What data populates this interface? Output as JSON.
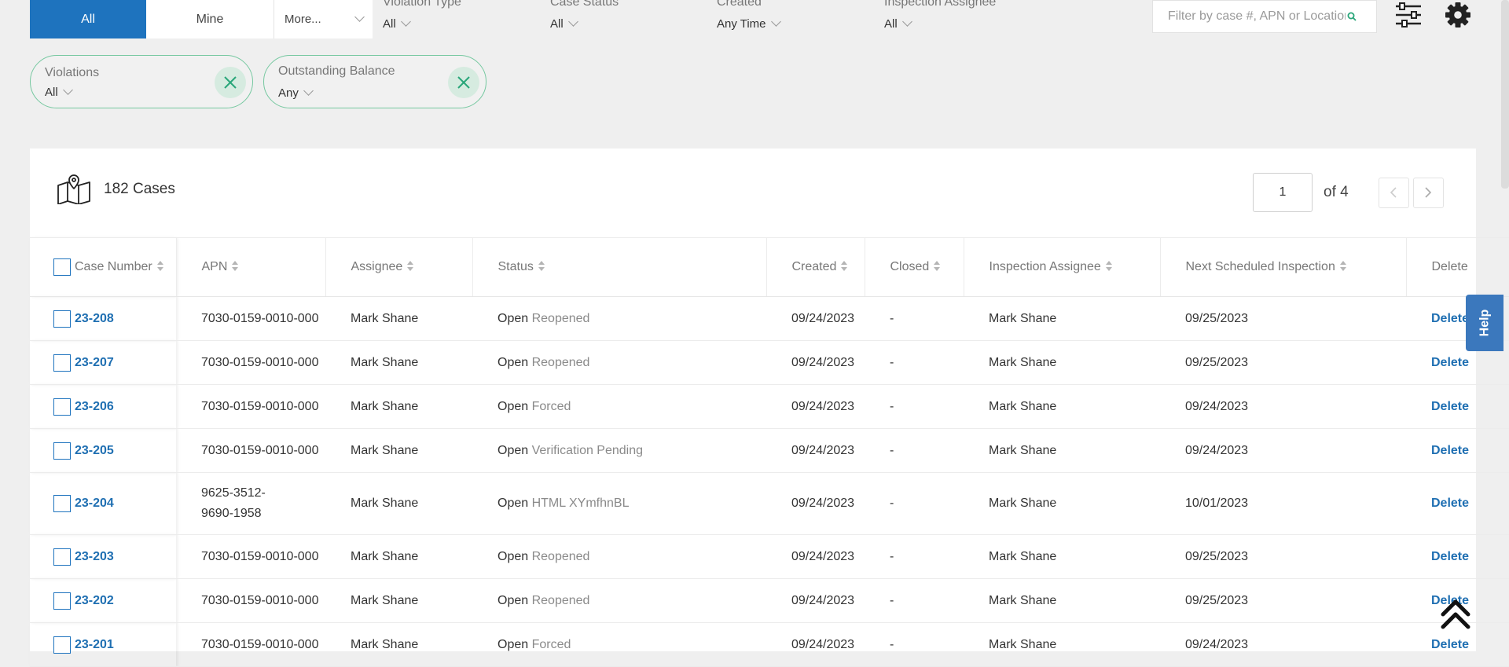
{
  "tabs": {
    "all": "All",
    "mine": "Mine",
    "more": "More..."
  },
  "filters": [
    {
      "label": "Violation Type",
      "value": "All"
    },
    {
      "label": "Case Status",
      "value": "All"
    },
    {
      "label": "Created",
      "value": "Any Time"
    },
    {
      "label": "Inspection Assignee",
      "value": "All"
    }
  ],
  "search": {
    "placeholder": "Filter by case #, APN or Location"
  },
  "chips": [
    {
      "label": "Violations",
      "value": "All"
    },
    {
      "label": "Outstanding Balance",
      "value": "Any"
    }
  ],
  "cases": {
    "count_label": "182 Cases"
  },
  "pager": {
    "page": "1",
    "of_label": "of 4"
  },
  "table": {
    "headers": [
      "Case Number",
      "APN",
      "Assignee",
      "Status",
      "Created",
      "Closed",
      "Inspection Assignee",
      "Next Scheduled Inspection",
      "Delete"
    ],
    "rows": [
      {
        "case": "23-208",
        "apn": "7030-0159-0010-000",
        "assignee": "Mark Shane",
        "status": "Open",
        "substatus": "Reopened",
        "created": "09/24/2023",
        "closed": "-",
        "inspector": "Mark Shane",
        "next": "09/25/2023",
        "action": "Delete"
      },
      {
        "case": "23-207",
        "apn": "7030-0159-0010-000",
        "assignee": "Mark Shane",
        "status": "Open",
        "substatus": "Reopened",
        "created": "09/24/2023",
        "closed": "-",
        "inspector": "Mark Shane",
        "next": "09/25/2023",
        "action": "Delete"
      },
      {
        "case": "23-206",
        "apn": "7030-0159-0010-000",
        "assignee": "Mark Shane",
        "status": "Open",
        "substatus": "Forced",
        "created": "09/24/2023",
        "closed": "-",
        "inspector": "Mark Shane",
        "next": "09/24/2023",
        "action": "Delete"
      },
      {
        "case": "23-205",
        "apn": "7030-0159-0010-000",
        "assignee": "Mark Shane",
        "status": "Open",
        "substatus": "Verification Pending",
        "created": "09/24/2023",
        "closed": "-",
        "inspector": "Mark Shane",
        "next": "09/24/2023",
        "action": "Delete"
      },
      {
        "case": "23-204",
        "apn": "9625-3512-9690-1958",
        "assignee": "Mark Shane",
        "status": "Open",
        "substatus": "HTML XYmfhnBL",
        "created": "09/24/2023",
        "closed": "-",
        "inspector": "Mark Shane",
        "next": "10/01/2023",
        "action": "Delete"
      },
      {
        "case": "23-203",
        "apn": "7030-0159-0010-000",
        "assignee": "Mark Shane",
        "status": "Open",
        "substatus": "Reopened",
        "created": "09/24/2023",
        "closed": "-",
        "inspector": "Mark Shane",
        "next": "09/25/2023",
        "action": "Delete"
      },
      {
        "case": "23-202",
        "apn": "7030-0159-0010-000",
        "assignee": "Mark Shane",
        "status": "Open",
        "substatus": "Reopened",
        "created": "09/24/2023",
        "closed": "-",
        "inspector": "Mark Shane",
        "next": "09/25/2023",
        "action": "Delete"
      },
      {
        "case": "23-201",
        "apn": "7030-0159-0010-000",
        "assignee": "Mark Shane",
        "status": "Open",
        "substatus": "Forced",
        "created": "09/24/2023",
        "closed": "-",
        "inspector": "Mark Shane",
        "next": "09/24/2023",
        "action": "Delete"
      }
    ]
  },
  "help": {
    "label": "Help"
  },
  "colors": {
    "primary": "#1e73be",
    "chip_border": "#76c8a0",
    "link": "#1f6fb2"
  }
}
